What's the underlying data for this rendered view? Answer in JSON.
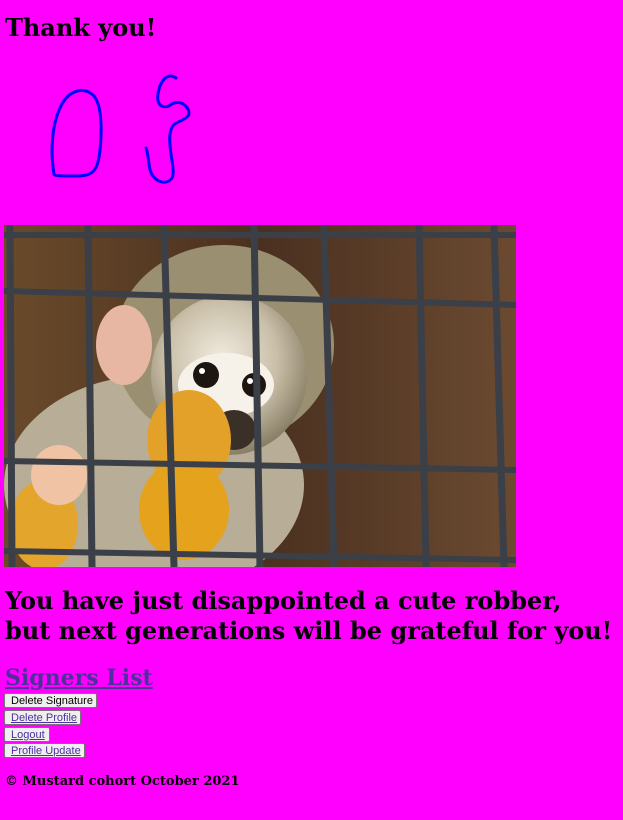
{
  "header": {
    "title": "Thank you!"
  },
  "signature": {
    "description_icon": "signature-drawing"
  },
  "image": {
    "alt": "squirrel monkey behind cage bars"
  },
  "message": {
    "line1": "You have just disappointed a cute robber,",
    "line2": "but next generations will be grateful for you!"
  },
  "nav": {
    "signers_link": "Signers List",
    "delete_signature": "Delete Signature",
    "delete_profile": "Delete Profile",
    "logout": "Logout",
    "profile_update": "Profile Update"
  },
  "footer": {
    "text": "© Mustard cohort October 2021"
  },
  "colors": {
    "background": "#ff00ff",
    "signature_stroke": "#0000ff",
    "link": "#4d2f9e"
  }
}
